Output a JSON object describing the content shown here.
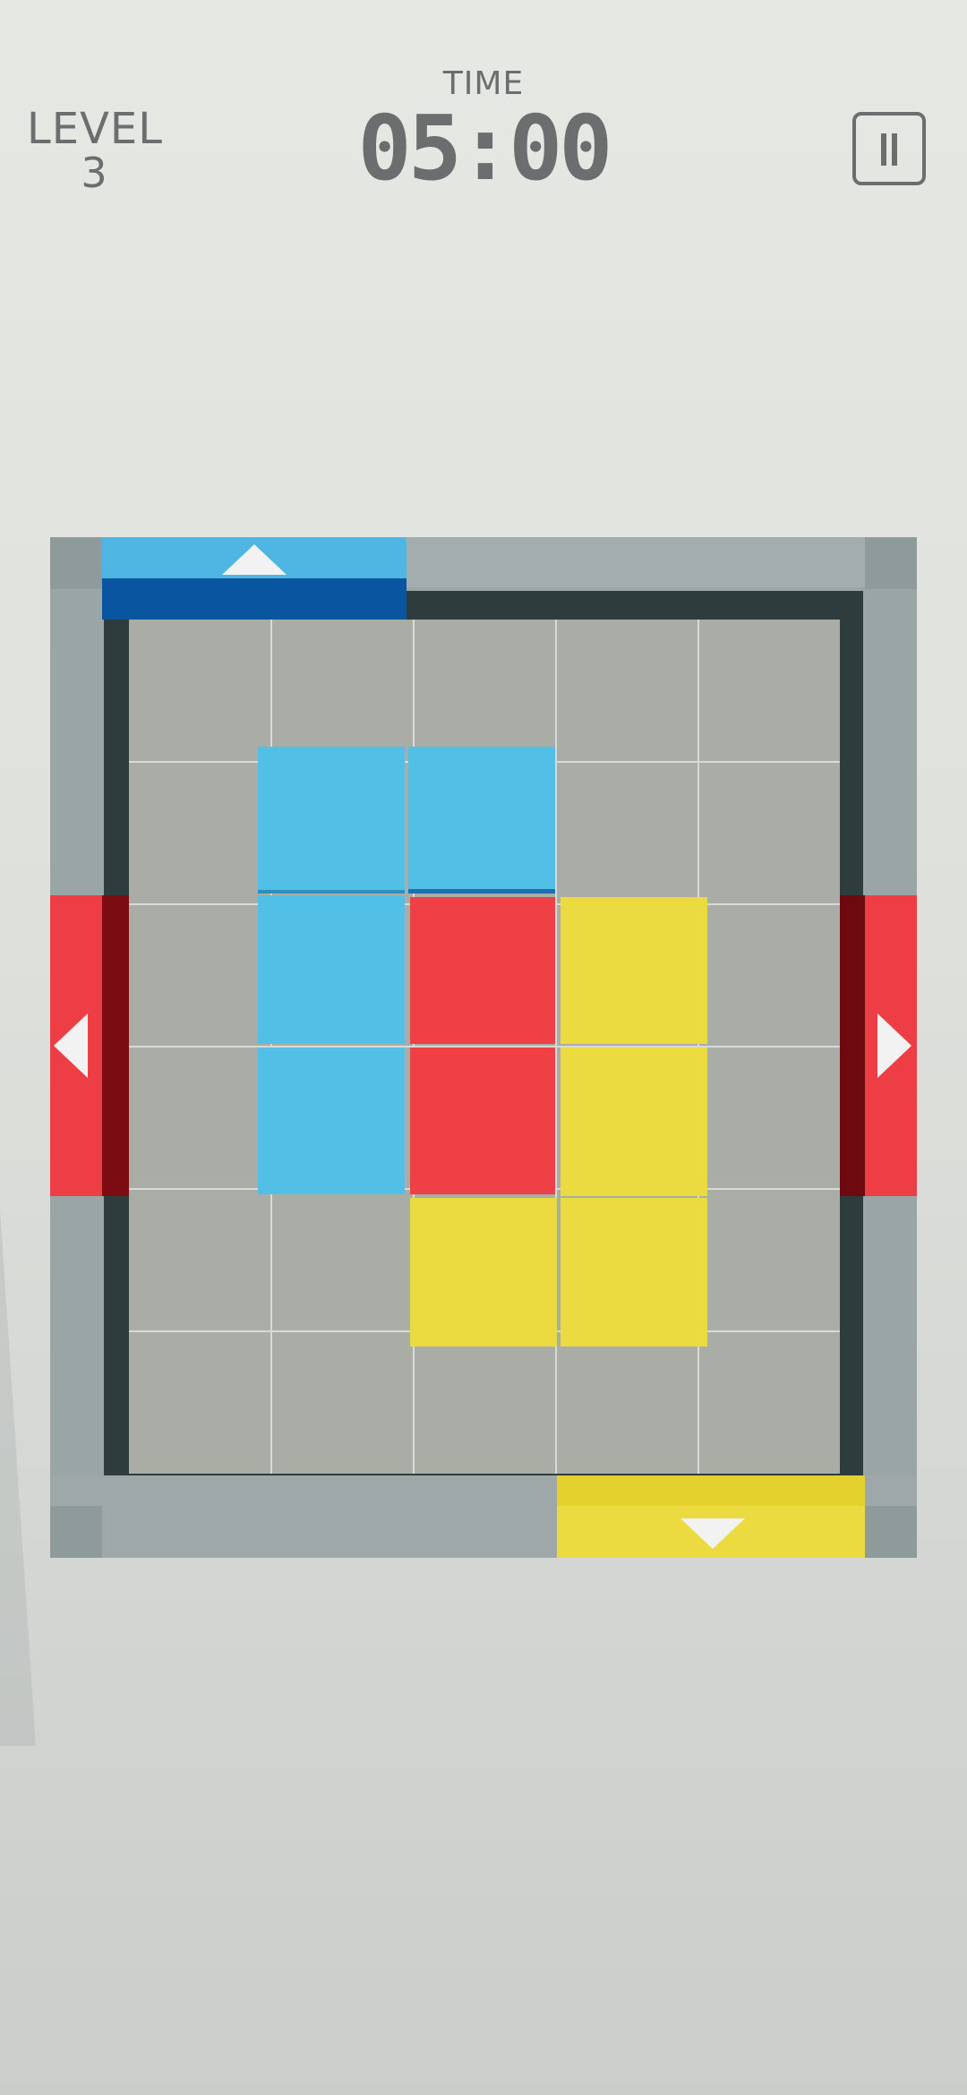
{
  "hud": {
    "level_label": "LEVEL",
    "level_number": "3",
    "time_label": "TIME",
    "time_value": "05:00"
  },
  "colors": {
    "blue": "#52bfe6",
    "red": "#ef4046",
    "yellow": "#ebdb40",
    "frame": "#9aa5a6",
    "cell": "#a9ada6"
  },
  "board": {
    "cols": 5,
    "rows": 6,
    "blocks": [
      {
        "color": "blue",
        "cells": [
          [
            1,
            1
          ],
          [
            2,
            1
          ],
          [
            1,
            2
          ],
          [
            1,
            3
          ]
        ]
      },
      {
        "color": "red",
        "cells": [
          [
            2,
            2
          ],
          [
            2,
            3
          ]
        ]
      },
      {
        "color": "yellow",
        "cells": [
          [
            3,
            2
          ],
          [
            3,
            3
          ],
          [
            3,
            4
          ],
          [
            2,
            4
          ]
        ]
      }
    ],
    "gates": [
      {
        "color": "blue",
        "side": "top",
        "icon": "arrow-up-icon"
      },
      {
        "color": "red",
        "side": "left",
        "icon": "arrow-left-icon"
      },
      {
        "color": "red",
        "side": "right",
        "icon": "arrow-right-icon"
      },
      {
        "color": "yellow",
        "side": "bottom",
        "icon": "arrow-down-icon"
      }
    ]
  }
}
